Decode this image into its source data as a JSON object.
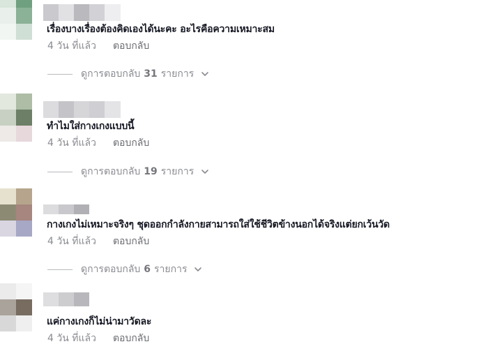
{
  "comments": [
    {
      "text": "เรื่องบางเรื่องต้องคิดเองได้นะคะ อะไรคือความเหมาะสม",
      "time": "4 วัน ที่แล้ว",
      "reply_label": "ตอบกลับ",
      "view_replies": {
        "prefix": "ดูการตอบกลับ",
        "count": "31",
        "suffix": "รายการ"
      },
      "avatar_colors": [
        "#d8e6dc",
        "#6fa07f",
        "#e9f0ec",
        "#8bb197",
        "#f2f6f3",
        "#cfdfd5"
      ],
      "username_colors": [
        "#c9c9ce",
        "#e1e1e4",
        "#b9b9be",
        "#d2d2d6",
        "#eeeef0"
      ]
    },
    {
      "text": "ทำไมใส่กางเกงแบบนี้",
      "time": "4 วัน ที่แล้ว",
      "reply_label": "ตอบกลับ",
      "view_replies": {
        "prefix": "ดูการตอบกลับ",
        "count": "19",
        "suffix": "รายการ"
      },
      "avatar_colors": [
        "#e3e8df",
        "#aebda6",
        "#c7d0c2",
        "#6d7f66",
        "#edeae8",
        "#e7d8dc"
      ],
      "username_colors": [
        "#dcdcdf",
        "#c4c4c8",
        "#d6d6d9",
        "#cfcfd3",
        "#e4e4e6"
      ]
    },
    {
      "text": "กางเกงไม่เหมาะจริงๆ ชุดออกกำลังกายสามารถใส่ใช้ชีวิตข้างนอกได้จริงแต่ยกเว้นวัด",
      "time": "4 วัน ที่แล้ว",
      "reply_label": "ตอบกลับ",
      "view_replies": {
        "prefix": "ดูการตอบกลับ",
        "count": "6",
        "suffix": "รายการ"
      },
      "avatar_colors": [
        "#e6e1cf",
        "#b6a58c",
        "#8d8a74",
        "#a7867f",
        "#d9d6e2",
        "#a7a7c6"
      ],
      "username_colors": [
        "#dcdcdf",
        "#c9c9cd",
        "#b0b0b5",
        "#e6e6ea",
        "#f2f2f4"
      ]
    },
    {
      "text": "แค่กางเกงก็ไม่น่ามาวัดละ",
      "time": "4 วัน ที่แล้ว",
      "reply_label": "ตอบกลับ",
      "avatar_colors": [
        "#ebebeb",
        "#f5f5f5",
        "#a9a39c",
        "#786b60",
        "#d8d8d8",
        "#efefef"
      ],
      "username_colors": [
        "#dedee0",
        "#cdcdd0",
        "#b8b8bc",
        "#e8e8ea"
      ]
    }
  ]
}
